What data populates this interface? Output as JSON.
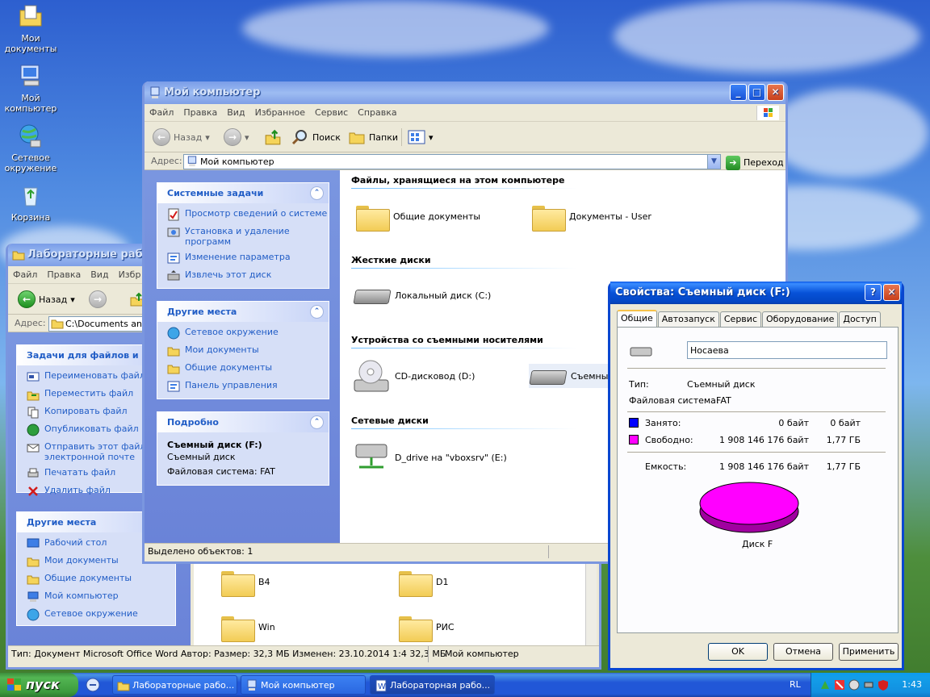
{
  "desktop": {
    "icons": [
      {
        "label": "Мои документы"
      },
      {
        "label": "Мой компьютер"
      },
      {
        "label": "Сетевое окружение"
      },
      {
        "label": "Корзина"
      }
    ]
  },
  "labwin": {
    "title": "Лабораторные работы",
    "menu": [
      "Файл",
      "Правка",
      "Вид",
      "Избр"
    ],
    "back_label": "Назад",
    "address_label": "Адрес:",
    "address_value": "C:\\Documents and S",
    "tasks_title": "Задачи для файлов и па",
    "tasks": [
      "Переименовать файл",
      "Переместить файл",
      "Копировать файл",
      "Опубликовать файл в",
      "Отправить этот файл по электронной почте",
      "Печатать файл",
      "Удалить файл"
    ],
    "places_title": "Другие места",
    "places": [
      "Рабочий стол",
      "Мои документы",
      "Общие документы",
      "Мой компьютер",
      "Сетевое окружение"
    ],
    "files": [
      "B4",
      "D1",
      "Win",
      "РИС"
    ],
    "status_left": "Тип: Документ Microsoft Office Word Автор: Размер: 32,3 МБ Изменен: 23.10.2014 1:4 32,3 МБ",
    "status_right": "Мой компьютер"
  },
  "mycomp": {
    "title": "Мой компьютер",
    "menu": [
      "Файл",
      "Правка",
      "Вид",
      "Избранное",
      "Сервис",
      "Справка"
    ],
    "toolbar": {
      "back": "Назад",
      "search": "Поиск",
      "folders": "Папки"
    },
    "address_label": "Адрес:",
    "address_value": "Мой компьютер",
    "go_label": "Переход",
    "system_tasks_title": "Системные задачи",
    "system_tasks": [
      "Просмотр сведений о системе",
      "Установка и удаление программ",
      "Изменение параметра",
      "Извлечь этот диск"
    ],
    "other_places_title": "Другие места",
    "other_places": [
      "Сетевое окружение",
      "Мои документы",
      "Общие документы",
      "Панель управления"
    ],
    "details_title": "Подробно",
    "details_name": "Съемный диск (F:)",
    "details_type": "Съемный диск",
    "details_fs": "Файловая система: FAT",
    "sections": {
      "files": "Файлы, хранящиеся на этом компьютере",
      "hdd": "Жесткие диски",
      "removable": "Устройства со съемными носителями",
      "network": "Сетевые диски"
    },
    "items": {
      "shared": "Общие документы",
      "user_docs": "Документы - User",
      "local_c": "Локальный диск (C:)",
      "cd": "CD-дисковод (D:)",
      "removable": "Съемный",
      "net_drive": "D_drive на \"vboxsrv\" (E:)"
    },
    "status": "Выделено объектов: 1"
  },
  "props": {
    "title": "Свойства: Съемный диск (F:)",
    "tabs": [
      "Общие",
      "Автозапуск",
      "Сервис",
      "Оборудование",
      "Доступ"
    ],
    "label_value": "Носаева",
    "type_label": "Тип:",
    "type_value": "Съемный диск",
    "fs_label": "Файловая система:",
    "fs_value": "FAT",
    "used_label": "Занято:",
    "used_bytes": "0 байт",
    "used_short": "0 байт",
    "free_label": "Свободно:",
    "free_bytes": "1 908 146 176 байт",
    "free_short": "1,77 ГБ",
    "cap_label": "Емкость:",
    "cap_bytes": "1 908 146 176 байт",
    "cap_short": "1,77 ГБ",
    "disk_label": "Диск F",
    "used_color": "#0000ff",
    "free_color": "#ff00ff",
    "ok": "OK",
    "cancel": "Отмена",
    "apply": "Применить"
  },
  "taskbar": {
    "start": "пуск",
    "tasks": [
      "Лабораторные рабо...",
      "Мой компьютер",
      "Лабораторная рабо..."
    ],
    "lang": "RL",
    "clock": "1:43"
  }
}
